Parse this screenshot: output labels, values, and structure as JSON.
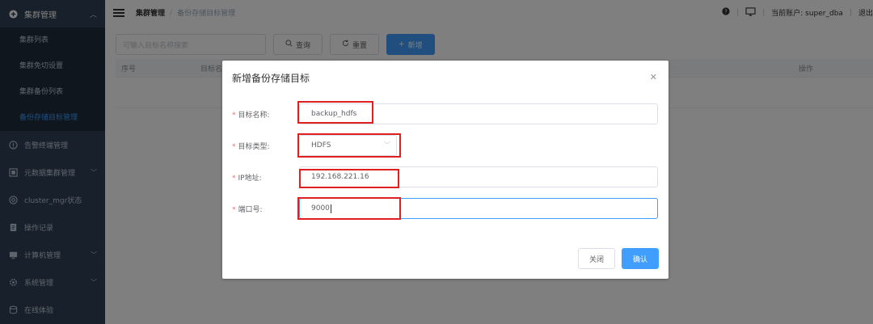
{
  "sidebar": {
    "group_title": "集群管理",
    "sub_items": [
      "集群列表",
      "集群免切设置",
      "集群备份列表",
      "备份存储目标管理"
    ],
    "active_sub_index": 3,
    "items": [
      "告警终端管理",
      "元数据集群管理",
      "cluster_mgr状态",
      "操作记录",
      "计算机管理",
      "系统管理",
      "在线体验"
    ]
  },
  "header": {
    "crumb_root": "集群管理",
    "crumb_sep": "/",
    "crumb_current": "备份存储目标管理",
    "account_label": "当前账户: super_dba",
    "logout_label": "退出",
    "divider": "|"
  },
  "toolbar": {
    "search_placeholder": "可输入目标名称搜索",
    "query_label": "查询",
    "reset_label": "重置",
    "add_label": "新增"
  },
  "table": {
    "columns": [
      "序号",
      "目标名",
      "操作"
    ]
  },
  "dialog": {
    "title": "新增备份存储目标",
    "fields": [
      {
        "label": "目标名称:",
        "value": "backup_hdfs"
      },
      {
        "label": "目标类型:",
        "value": "HDFS"
      },
      {
        "label": "IP地址:",
        "value": "192.168.221.16"
      },
      {
        "label": "端口号:",
        "value": "9000"
      }
    ],
    "cancel_label": "关闭",
    "confirm_label": "确认"
  },
  "colors": {
    "sidebar_bg": "#304156",
    "submenu_bg": "#1f2d3d",
    "accent": "#409eff",
    "highlight": "#e02020"
  }
}
